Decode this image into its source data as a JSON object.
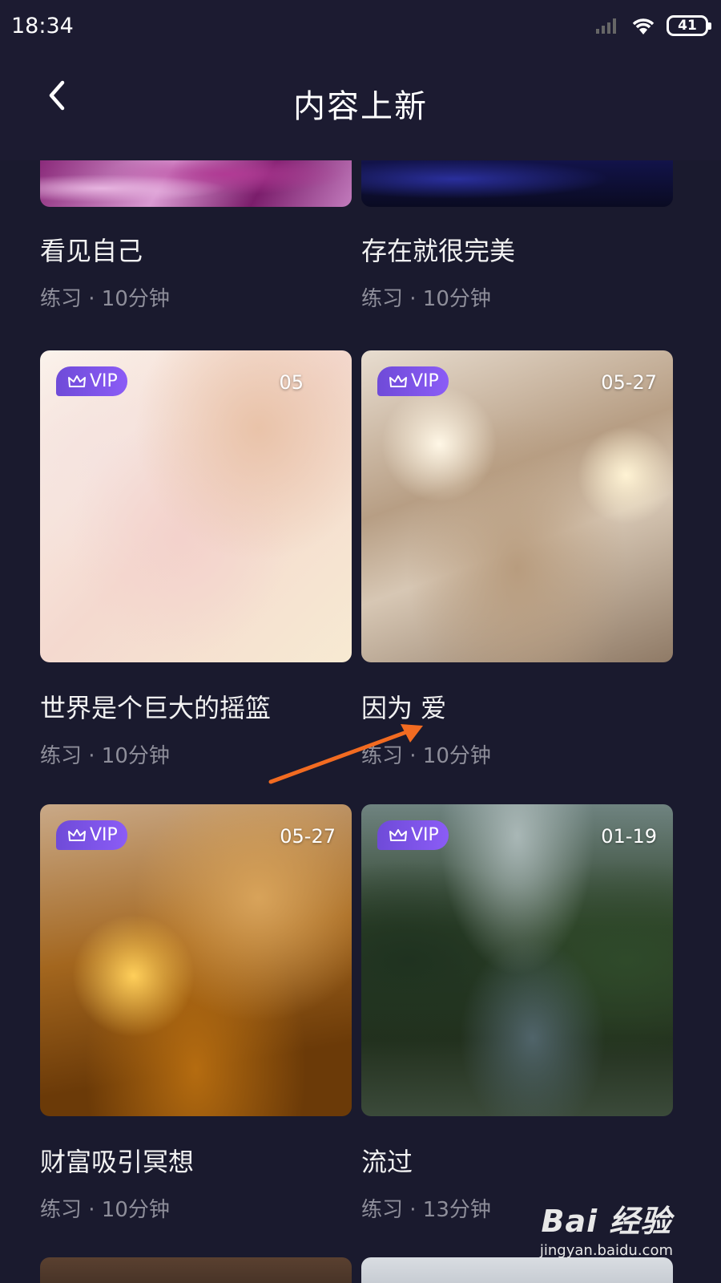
{
  "status_bar": {
    "time": "18:34",
    "battery": "41"
  },
  "header": {
    "title": "内容上新"
  },
  "cards": [
    {
      "title": "看见自己",
      "meta": "练习 · 10分钟",
      "vip": "",
      "date": "",
      "image": "purple-paint"
    },
    {
      "title": "存在就很完美",
      "meta": "练习 · 10分钟",
      "vip": "",
      "date": "",
      "image": "blue-dark"
    },
    {
      "title": "世界是个巨大的摇篮",
      "meta": "练习 · 10分钟",
      "vip": "VIP",
      "date": "05",
      "image": "baby-hand"
    },
    {
      "title": "因为 爱",
      "meta": "练习 · 10分钟",
      "vip": "VIP",
      "date": "05-27",
      "image": "sparkling-water"
    },
    {
      "title": "财富吸引冥想",
      "meta": "练习 · 10分钟",
      "vip": "VIP",
      "date": "05-27",
      "image": "golden-wave"
    },
    {
      "title": "流过",
      "meta": "练习 · 13分钟",
      "vip": "VIP",
      "date": "01-19",
      "image": "forest-stream"
    }
  ],
  "watermark": {
    "logo": "Bai 经验",
    "url": "jingyan.baidu.com"
  }
}
